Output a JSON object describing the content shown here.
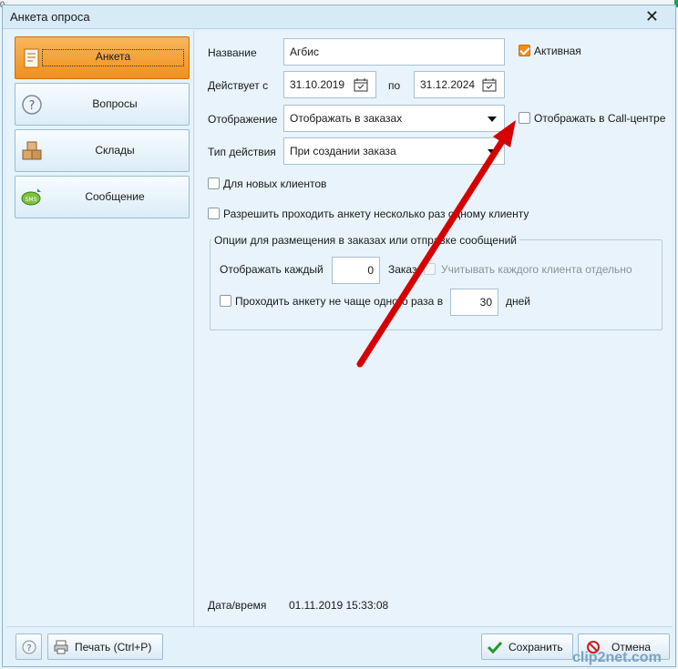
{
  "window": {
    "title": "Анкета опроса"
  },
  "sidebar": {
    "items": [
      {
        "label": "Анкета",
        "icon": "survey-icon",
        "active": true
      },
      {
        "label": "Вопросы",
        "icon": "question-icon",
        "active": false
      },
      {
        "label": "Склады",
        "icon": "boxes-icon",
        "active": false
      },
      {
        "label": "Сообщение",
        "icon": "sms-icon",
        "active": false
      }
    ]
  },
  "form": {
    "name_label": "Название",
    "name_value": "Агбис",
    "active_label": "Активная",
    "active_checked": true,
    "valid_from_label": "Действует с",
    "valid_from": "31.10.2019",
    "valid_to_label": "по",
    "valid_to": "31.12.2024",
    "display_label": "Отображение",
    "display_value": "Отображать в заказах",
    "callcenter_label": "Отображать в Call-центре",
    "callcenter_checked": false,
    "action_label": "Тип действия",
    "action_value": "При создании заказа",
    "new_clients_label": "Для новых клиентов",
    "multiple_label": "Разрешить проходить анкету несколько раз одному клиенту"
  },
  "options": {
    "title": "Опции для размещения в заказах или отправке сообщений",
    "show_each_label": "Отображать каждый",
    "show_each_value": "0",
    "order_label": "Заказ",
    "count_each_client_label": "Учитывать каждого клиента отдельно",
    "limit_label": "Проходить анкету не чаще одного раза в",
    "limit_value": "30",
    "days_label": "дней"
  },
  "datetime": {
    "label": "Дата/время",
    "value": "01.11.2019 15:33:08"
  },
  "footer": {
    "print_label": "Печать (Ctrl+P)",
    "save_label": "Сохранить",
    "cancel_label": "Отмена"
  },
  "top_left_fragment": "0",
  "watermark": "clip2net.com",
  "colors": {
    "accent_orange": "#f28f1c",
    "annotation_red": "#d60000",
    "save_green": "#1f9a2a",
    "cancel_red": "#cc1f1f"
  }
}
